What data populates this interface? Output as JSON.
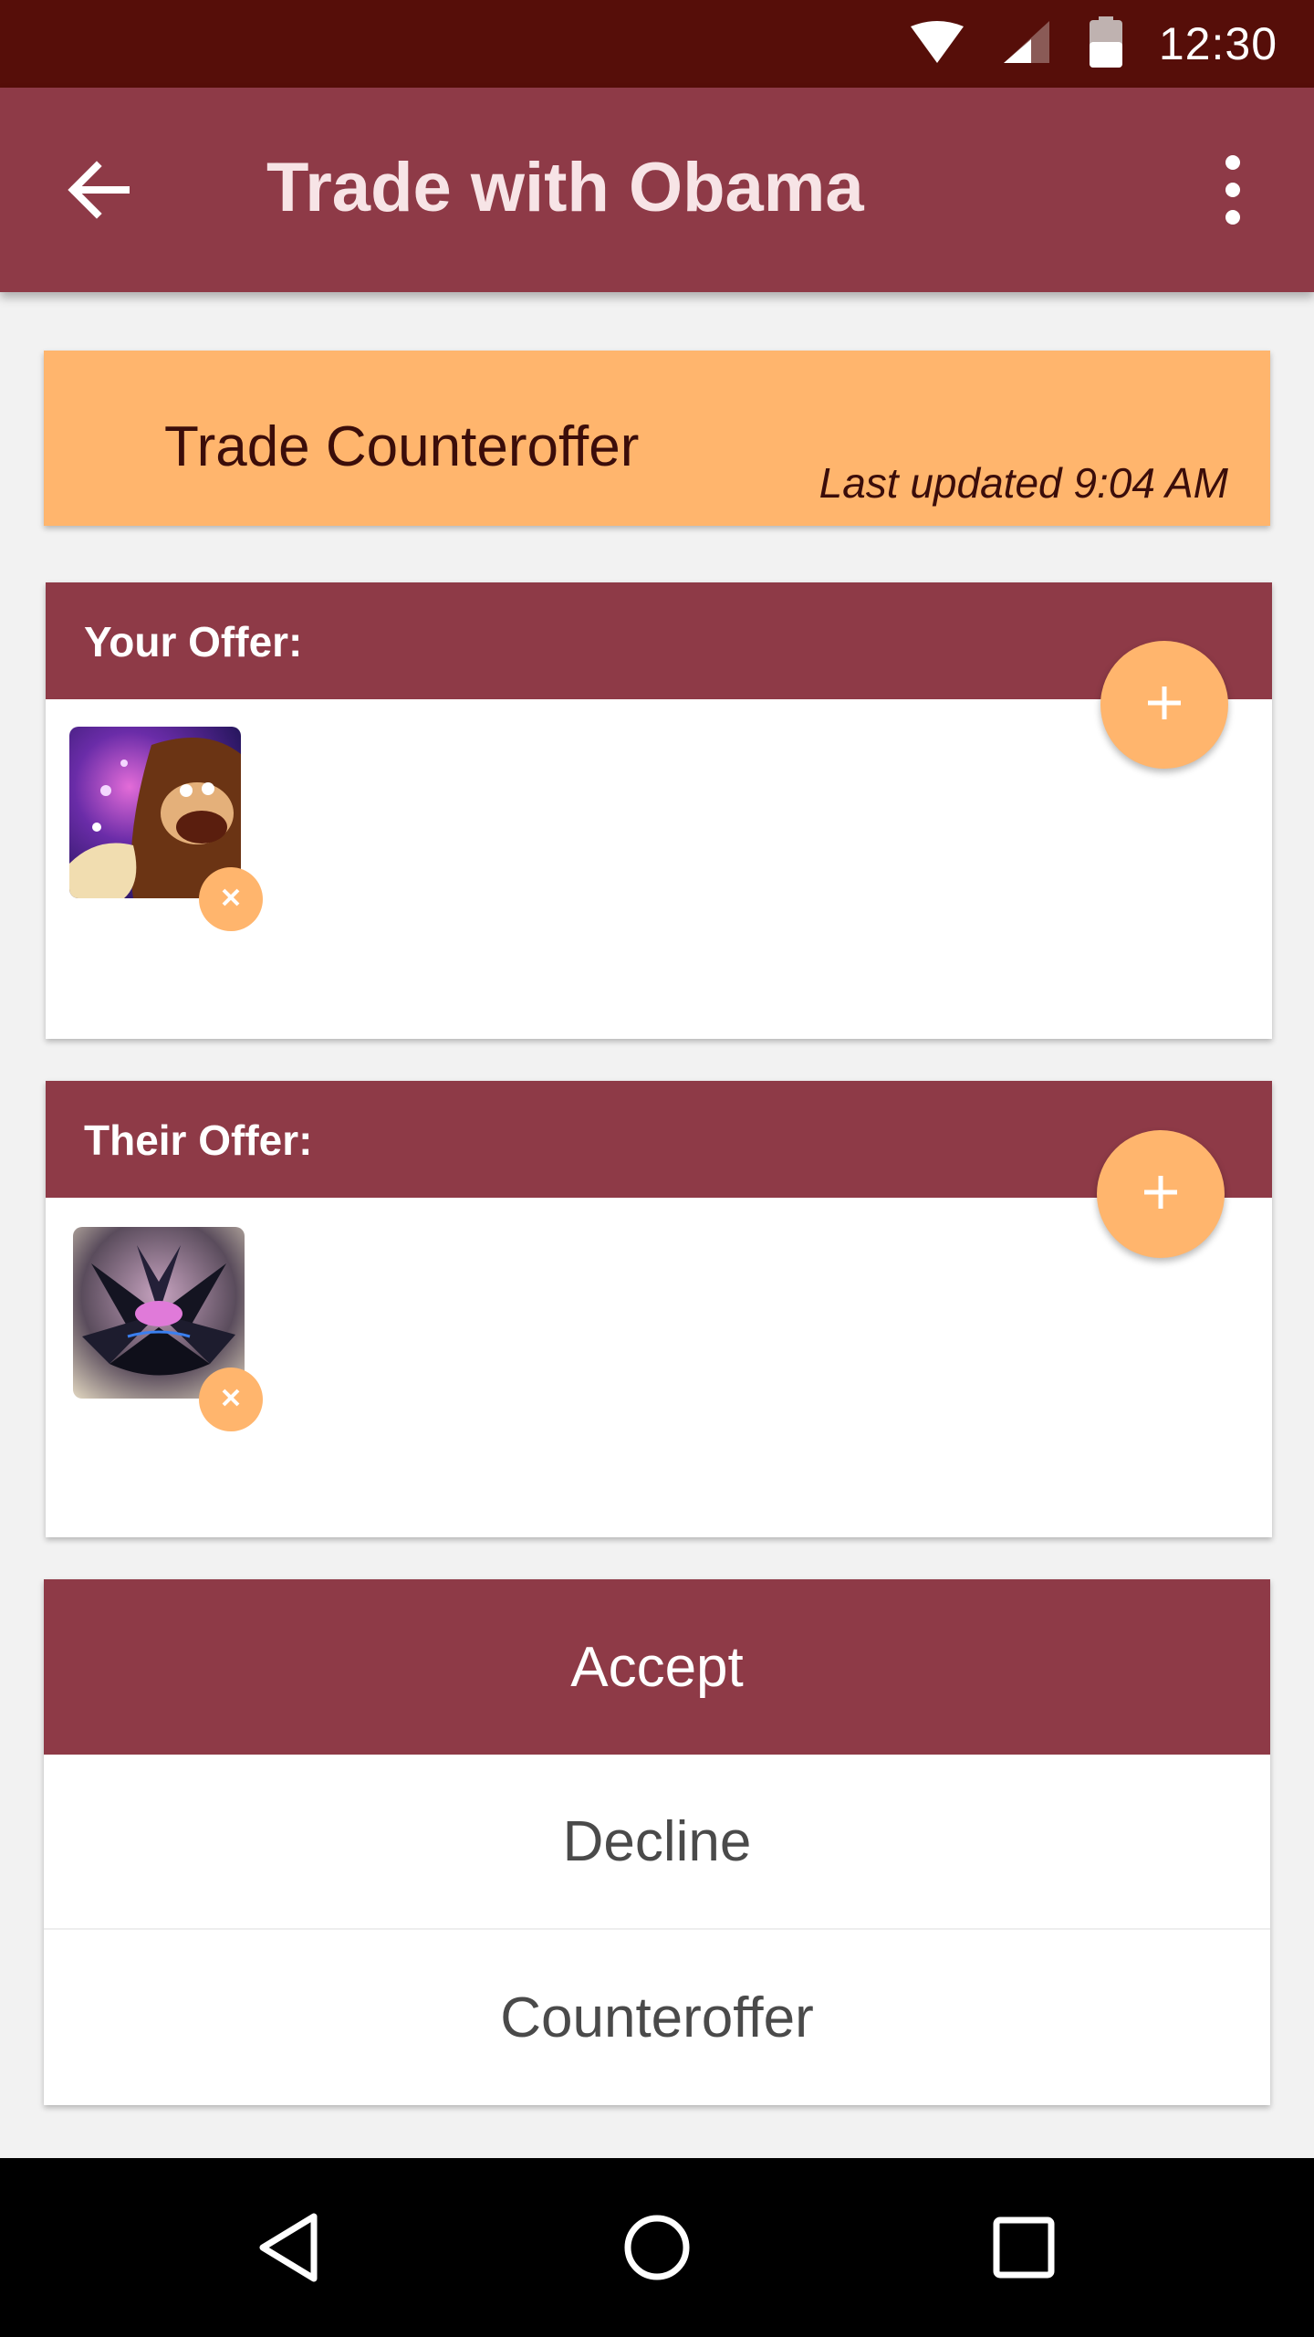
{
  "status_bar": {
    "time": "12:30",
    "icons": [
      "wifi-icon",
      "cell-signal-icon",
      "battery-icon"
    ]
  },
  "app_bar": {
    "title": "Trade with Obama",
    "back_icon": "arrow-back-icon",
    "menu_icon": "more-vert-icon"
  },
  "trade": {
    "title": "Trade Counteroffer",
    "updated": "Last updated 9:04 AM"
  },
  "your_offer": {
    "label": "Your Offer:",
    "add_icon": "plus-icon",
    "cards": [
      {
        "image": "card-art-gorilla-character",
        "remove_icon": "close-icon"
      }
    ]
  },
  "their_offer": {
    "label": "Their Offer:",
    "add_icon": "plus-icon",
    "cards": [
      {
        "image": "card-art-black-lotus",
        "remove_icon": "close-icon"
      }
    ]
  },
  "actions": {
    "accept": "Accept",
    "decline": "Decline",
    "counteroffer": "Counteroffer"
  },
  "nav_bar": {
    "icons": [
      "nav-back-icon",
      "nav-home-icon",
      "nav-recents-icon"
    ]
  },
  "colors": {
    "status_bar": "#560e09",
    "primary": "#8e3a47",
    "accent": "#ffb56d",
    "background": "#f2f2f2"
  }
}
